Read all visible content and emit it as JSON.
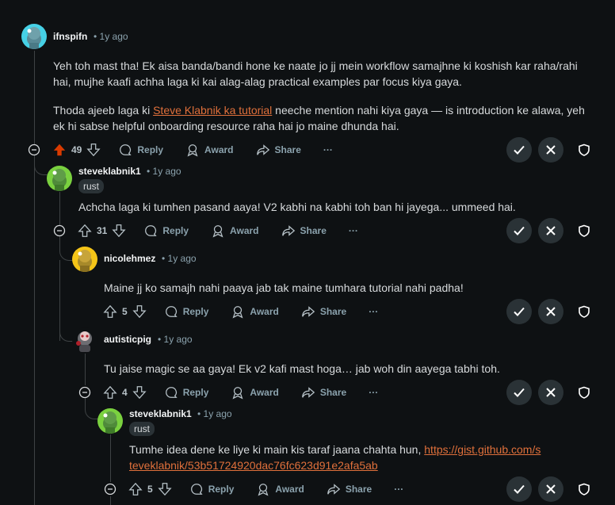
{
  "actions": {
    "reply": "Reply",
    "award": "Award",
    "share": "Share",
    "more": "···"
  },
  "comments": [
    {
      "author": "ifnspifn",
      "time": "• 1y ago",
      "body": [
        "Yeh toh mast tha! Ek aisa banda/bandi hone ke naate jo jj mein workflow samajhne ki koshish kar raha/rahi hai, mujhe kaafi achha laga ki kai alag-alag practical examples par focus kiya gaya."
      ],
      "body2_pre": "Thoda ajeeb laga ki ",
      "body2_link": "Steve Klabnik ka tutorial",
      "body2_post": " neeche mention nahi kiya gaya — is introduction ke alawa, yeh ek hi sabse helpful onboarding resource raha hai jo maine dhunda hai.",
      "score": "49"
    },
    {
      "author": "steveklabnik1",
      "time": "• 1y ago",
      "flair": "rust",
      "body": "Achcha laga ki tumhen pasand aaya! V2 kabhi na kabhi toh ban hi jayega... ummeed hai.",
      "score": "31"
    },
    {
      "author": "nicolehmez",
      "time": "• 1y ago",
      "body": "Maine jj ko samajh nahi paaya jab tak maine tumhara tutorial nahi padha!",
      "score": "5"
    },
    {
      "author": "autisticpig",
      "time": "• 1y ago",
      "body": "Tu jaise magic se aa gaya! Ek v2 kafi mast hoga… jab woh din aayega tabhi toh.",
      "score": "4"
    },
    {
      "author": "steveklabnik1",
      "time": "• 1y ago",
      "flair": "rust",
      "body_pre": "Tumhe idea dene ke liye ki main kis taraf jaana chahta hun, ",
      "body_link": "https://gist.github.com/steveklabnik/53b51724920dac76fc623d91e2afa5ab",
      "score": "5"
    }
  ],
  "colors": {
    "upvoted": "#d93a00",
    "link": "#e0703b",
    "avatar_teal": "#46d1e6",
    "avatar_green": "#7ad13f",
    "avatar_yellow": "#f5c518"
  }
}
